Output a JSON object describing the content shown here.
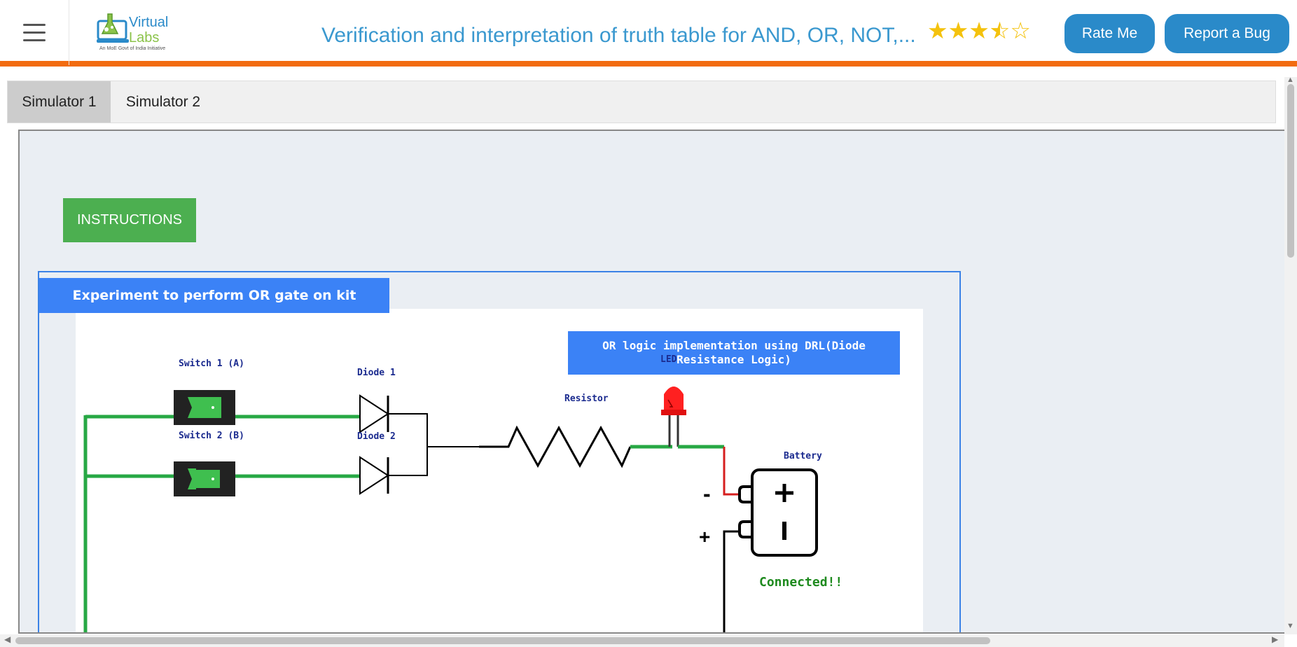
{
  "header": {
    "logo_text_1": "Virtual",
    "logo_text_2": "Labs",
    "logo_subtext": "An MoE Govt of India Initiative",
    "title": "Verification and interpretation of truth table for AND, OR, NOT,...",
    "rating": 3.5,
    "rating_max": 5,
    "rate_button": "Rate Me",
    "bug_button": "Report a Bug"
  },
  "tabs": [
    {
      "label": "Simulator 1",
      "active": true
    },
    {
      "label": "Simulator 2",
      "active": false
    }
  ],
  "simulator": {
    "instructions_button": "INSTRUCTIONS",
    "experiment_title": "Experiment to perform OR gate on kit",
    "circuit_title": "OR logic implementation using DRL(Diode Resistance Logic)",
    "labels": {
      "switch1": "Switch 1 (A)",
      "switch2": "Switch 2 (B)",
      "diode1": "Diode 1",
      "diode2": "Diode 2",
      "resistor": "Resistor",
      "led": "LED",
      "battery": "Battery",
      "minus": "-",
      "plus": "+"
    },
    "status": "Connected!!",
    "switch1_on": true,
    "switch2_on": true,
    "led_on": true
  },
  "colors": {
    "accent_orange": "#f26b0f",
    "brand_blue": "#2a8ac9",
    "title_blue": "#3a98cf",
    "panel_blue": "#3b82f6",
    "green": "#4caf50",
    "wire_green": "#27a844",
    "wire_red": "#d61f1f"
  }
}
